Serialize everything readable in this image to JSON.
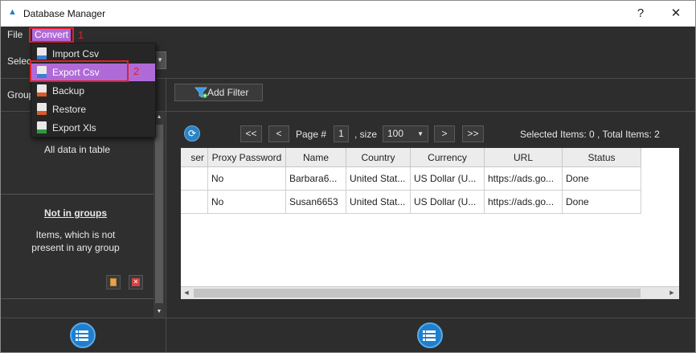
{
  "window": {
    "title": "Database Manager",
    "help_label": "?",
    "close_label": "✕"
  },
  "menubar": {
    "file_label": "File",
    "convert_label": "Convert"
  },
  "annotations": {
    "step1": "1",
    "step2": "2"
  },
  "convert_menu": {
    "items": [
      {
        "label": "Import Csv",
        "icon": "csv-file-icon",
        "active": false
      },
      {
        "label": "Export Csv",
        "icon": "csv-file-icon",
        "active": true
      },
      {
        "label": "Backup",
        "icon": "backup-file-icon",
        "active": false
      },
      {
        "label": "Restore",
        "icon": "restore-file-icon",
        "active": false
      },
      {
        "label": "Export Xls",
        "icon": "xls-file-icon",
        "active": false
      }
    ]
  },
  "left": {
    "select_label": "Selec",
    "group_label": "Group",
    "all_data": "All data in table",
    "not_in_groups_title": "Not in groups",
    "not_in_groups_desc_line1": "Items, which is not",
    "not_in_groups_desc_line2": "present in any group"
  },
  "toolbar": {
    "add_filter_label": "Add Filter"
  },
  "pager": {
    "first_label": "<<",
    "prev_label": "<",
    "page_label": "Page #",
    "page_value": "1",
    "size_label": ", size",
    "size_value": "100",
    "next_label": ">",
    "last_label": ">>",
    "summary": "Selected Items:  0 ,  Total Items:  2"
  },
  "grid": {
    "columns": [
      "ser",
      "Proxy Password",
      "Name",
      "Country",
      "Currency",
      "URL",
      "Status"
    ],
    "rows": [
      [
        "",
        "No",
        "Barbara6...",
        "United Stat...",
        "US Dollar (U...",
        "https://ads.go...",
        "Done"
      ],
      [
        "",
        "No",
        "Susan6653",
        "United Stat...",
        "US Dollar (U...",
        "https://ads.go...",
        "Done"
      ]
    ]
  },
  "colors": {
    "accent": "#b06ad8",
    "marker": "#e0212a",
    "primary_blue": "#1e7fd0",
    "background": "#2d2d2d"
  }
}
